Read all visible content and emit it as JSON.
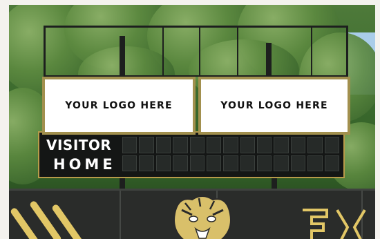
{
  "logos": {
    "left_text": "YOUR LOGO HERE",
    "right_text": "YOUR LOGO HERE"
  },
  "scoreboard": {
    "visitor_label": "VISITOR",
    "home_label": "HOME"
  },
  "colors": {
    "gold_border": "#a2904e",
    "scoreboard_bg": "#141615",
    "claw_gold": "#e2c766"
  }
}
